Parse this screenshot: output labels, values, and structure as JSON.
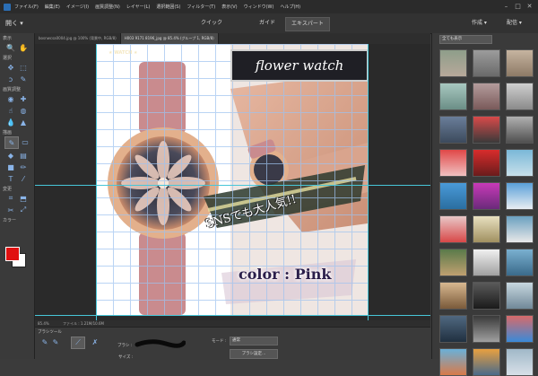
{
  "menubar": {
    "items": [
      "ファイル(F)",
      "編集(E)",
      "イメージ(I)",
      "画質調整(N)",
      "レイヤー(L)",
      "選択範囲(S)",
      "フィルター(T)",
      "表示(V)",
      "ウィンドウ(W)",
      "ヘルプ(H)"
    ],
    "controls": [
      "–",
      "□",
      "✕"
    ]
  },
  "modebar": {
    "open": "開く",
    "tabs": [
      "クイック",
      "ガイド",
      "エキスパート"
    ],
    "active_tab": "エキスパート",
    "create": "作成",
    "share": "配信"
  },
  "toolbox": {
    "sections": [
      "表示",
      "選択",
      "画質調整",
      "描画",
      "変更",
      "カラー"
    ],
    "fg_color": "#e01010",
    "bg_color": "#ffffff"
  },
  "doc_tabs": [
    "bosnwcsa0004.jpg @ 100% (背景中, RGB/8)",
    "H003 9171 8196_jpg @ 85.4% (グループ 1, RGB/8)"
  ],
  "canvas": {
    "brand": "★ WATCH ★",
    "title": "flower watch",
    "sns_text": "SNSでも大人気!!",
    "color_text": "color : Pink"
  },
  "status": {
    "zoom": "85.4%",
    "file": "ファイル : 1.21M/10.6M"
  },
  "options": {
    "tool_name": "ブラシツール",
    "brush_label": "ブラシ :",
    "mode_label": "モード :",
    "mode_value": "通常",
    "settings_button": "ブラシ設定...",
    "size_label": "サイズ :"
  },
  "panel": {
    "filter_select": "全ても表示"
  }
}
